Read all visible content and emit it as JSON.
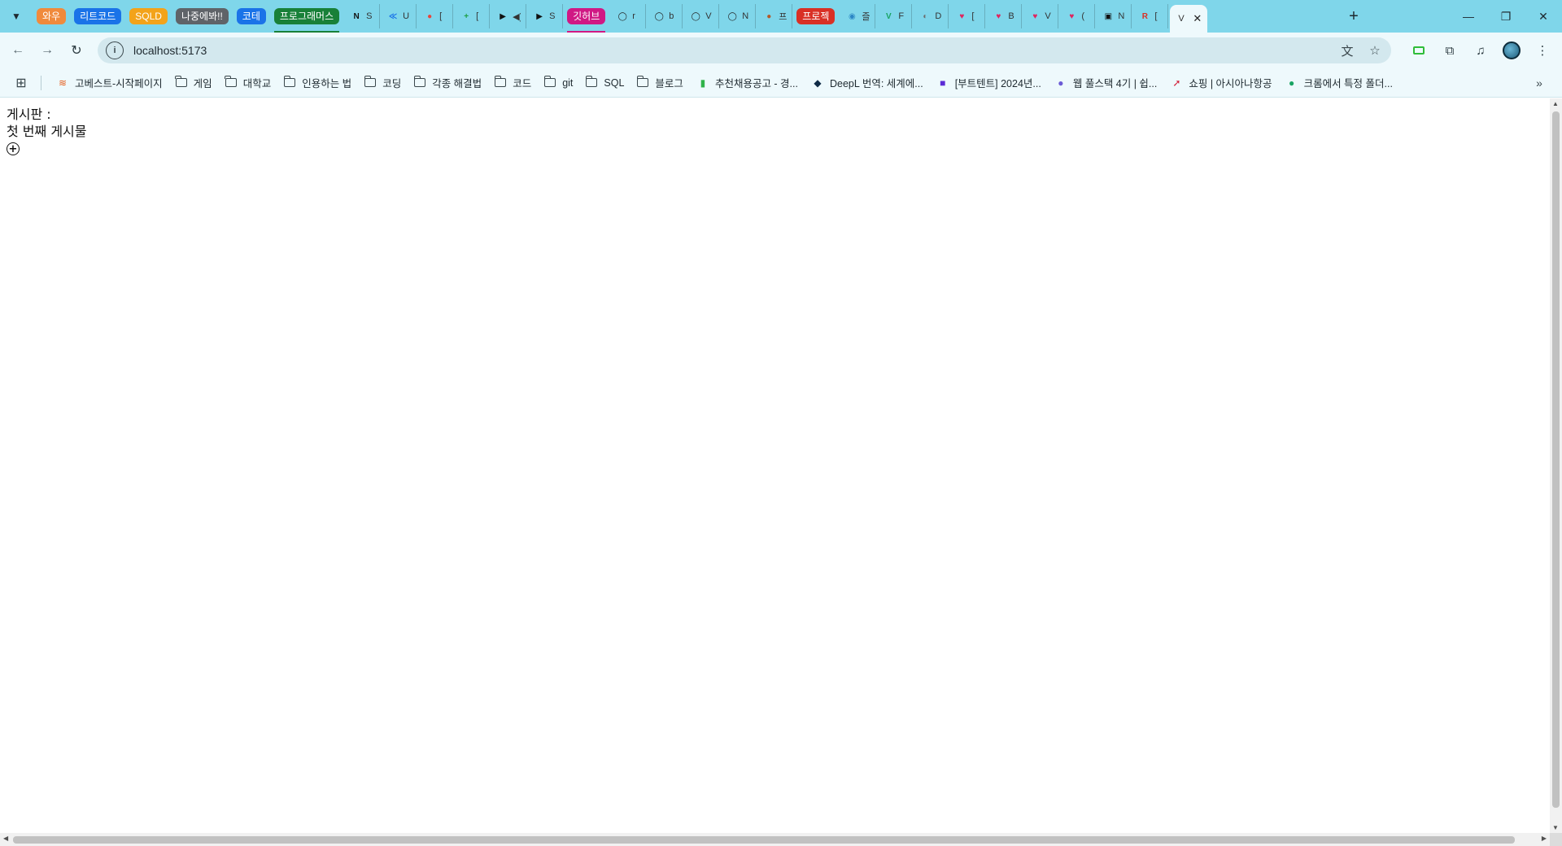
{
  "tab_groups": [
    {
      "label": "와우",
      "color": "#f08a3c"
    },
    {
      "label": "리트코드",
      "color": "#1a73e8"
    },
    {
      "label": "SQLD",
      "color": "#f3a31a"
    },
    {
      "label": "나중에봐!!",
      "color": "#5f6368"
    },
    {
      "label": "코테",
      "color": "#1a73e8"
    },
    {
      "label": "프로그래머스",
      "color": "#188038"
    },
    {
      "label": "깃허브",
      "color": "#d01884"
    },
    {
      "label": "프로젝",
      "color": "#d93025"
    }
  ],
  "tabs": [
    {
      "fav": "N",
      "fav_color": "#111111",
      "text": "S"
    },
    {
      "fav": "≪",
      "fav_color": "#1a73e8",
      "text": "U"
    },
    {
      "fav": "●",
      "fav_color": "#e8453c",
      "text": "["
    },
    {
      "fav": "+",
      "fav_color": "#1e9e45",
      "text": "["
    },
    {
      "fav": "▶",
      "fav_color": "#111111",
      "text": "◀)"
    },
    {
      "fav": "▶",
      "fav_color": "#111111",
      "text": "S"
    },
    {
      "fav": "◯",
      "fav_color": "#222222",
      "text": "r"
    },
    {
      "fav": "◯",
      "fav_color": "#222222",
      "text": "b"
    },
    {
      "fav": "◯",
      "fav_color": "#222222",
      "text": "V"
    },
    {
      "fav": "◯",
      "fav_color": "#222222",
      "text": "N"
    },
    {
      "fav": "●",
      "fav_color": "#b35a2a",
      "text": "프"
    },
    {
      "fav": "◉",
      "fav_color": "#2b86c5",
      "text": "즐"
    },
    {
      "fav": "V",
      "fav_color": "#19a463",
      "text": "F"
    },
    {
      "fav": "◐",
      "fav_color": "#6d6d6d",
      "text": "D"
    },
    {
      "fav": "♥",
      "fav_color": "#e0245e",
      "text": "["
    },
    {
      "fav": "♥",
      "fav_color": "#e0245e",
      "text": "B"
    },
    {
      "fav": "♥",
      "fav_color": "#e0245e",
      "text": "V"
    },
    {
      "fav": "♥",
      "fav_color": "#e0245e",
      "text": "("
    },
    {
      "fav": "▣",
      "fav_color": "#111111",
      "text": "N"
    },
    {
      "fav": "R",
      "fav_color": "#d93025",
      "text": "["
    }
  ],
  "active_tab": {
    "text": "V"
  },
  "toolbar": {
    "url": "localhost:5173"
  },
  "bookmarks": [
    {
      "type": "site",
      "icon": "≋",
      "icon_color": "#e65c1a",
      "label": "고베스트-시작페이지"
    },
    {
      "type": "folder",
      "label": "게임"
    },
    {
      "type": "folder",
      "label": "대학교"
    },
    {
      "type": "folder",
      "label": "인용하는 법"
    },
    {
      "type": "folder",
      "label": "코딩"
    },
    {
      "type": "folder",
      "label": "각종 해결법"
    },
    {
      "type": "folder",
      "label": "코드"
    },
    {
      "type": "folder",
      "label": "git"
    },
    {
      "type": "folder",
      "label": "SQL"
    },
    {
      "type": "folder",
      "label": "블로그"
    },
    {
      "type": "site",
      "icon": "▮",
      "icon_color": "#2fb34a",
      "label": "추천채용공고 - 경..."
    },
    {
      "type": "site",
      "icon": "◆",
      "icon_color": "#0f2b46",
      "label": "DeepL 번역: 세계에..."
    },
    {
      "type": "site",
      "icon": "■",
      "icon_color": "#5b2bd6",
      "label": "[부트텐트] 2024년..."
    },
    {
      "type": "site",
      "icon": "●",
      "icon_color": "#6b5bd6",
      "label": "웹 풀스택 4기 | 쉽..."
    },
    {
      "type": "site",
      "icon": "➚",
      "icon_color": "#d1213a",
      "label": "쇼핑 | 아시아나항공"
    },
    {
      "type": "site",
      "icon": "●",
      "icon_color": "#19a463",
      "label": "크롬에서 특정 폴더..."
    }
  ],
  "page": {
    "board_title": "게시판 :",
    "posts": [
      "첫 번째 게시물"
    ],
    "add_symbol": "+"
  },
  "icons": {
    "tab_search": "chevron-down-icon",
    "new_tab": "plus-icon",
    "back": "arrow-left-icon",
    "forward": "arrow-right-icon",
    "reload": "reload-icon",
    "translate": "translate-icon",
    "bookmark_star": "star-icon",
    "extensions": "puzzle-icon",
    "media": "media-control-icon",
    "profile": "avatar",
    "menu": "kebab-menu-icon"
  },
  "colors": {
    "tabstrip_bg": "#7fd6ea",
    "toolbar_bg": "#eef9fc",
    "omnibox_bg": "#d3e8ee"
  }
}
